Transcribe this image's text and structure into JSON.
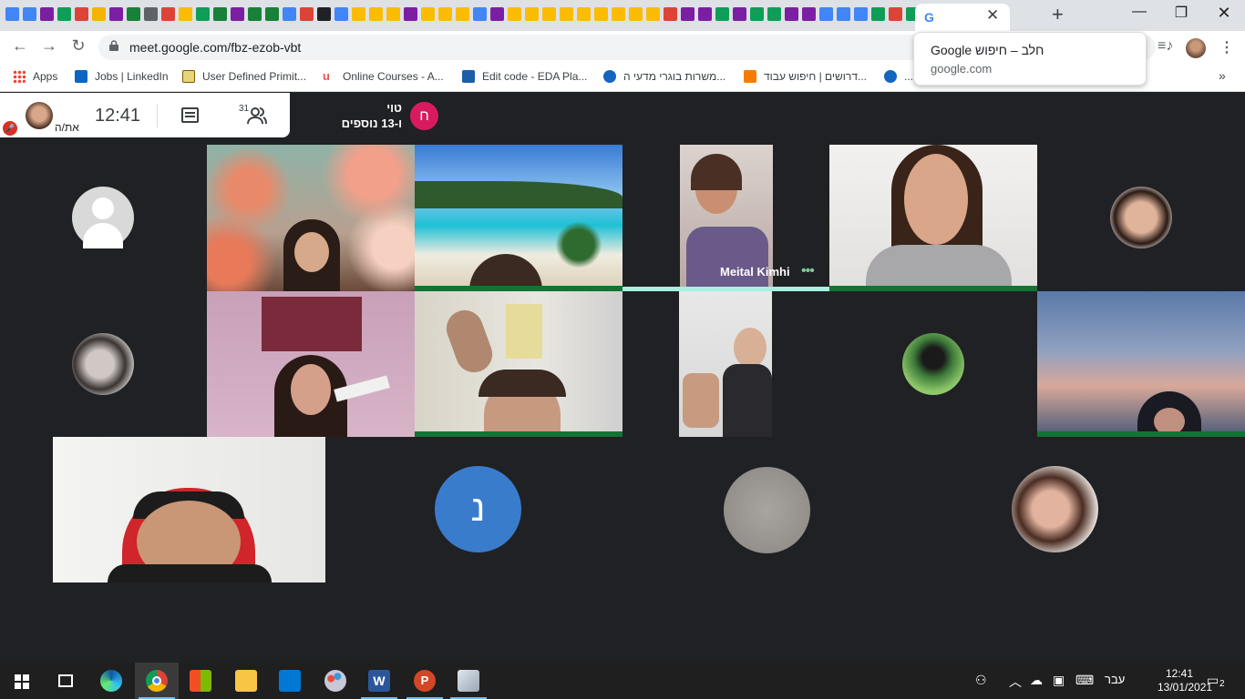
{
  "browser": {
    "active_tab_icon": "G",
    "url": "meet.google.com/fbz-ezob-vbt",
    "tab_icon_colors": [
      "#4285f4",
      "#4285f4",
      "#7b1fa2",
      "#0f9d58",
      "#db4437",
      "#f4b400",
      "#7b1fa2",
      "#188038",
      "#5f6368",
      "#db4437",
      "#fbbc04",
      "#0f9d58",
      "#188038",
      "#7b1fa2",
      "#188038",
      "#188038",
      "#4285f4",
      "#db4437",
      "#202124",
      "#4285f4",
      "#fbbc04",
      "#fbbc04",
      "#fbbc04",
      "#7b1fa2",
      "#fbbc04",
      "#fbbc04",
      "#fbbc04",
      "#4285f4",
      "#7b1fa2",
      "#fbbc04",
      "#fbbc04",
      "#fbbc04",
      "#fbbc04",
      "#fbbc04",
      "#fbbc04",
      "#fbbc04",
      "#fbbc04",
      "#fbbc04",
      "#db4437",
      "#7b1fa2",
      "#7b1fa2",
      "#0f9d58",
      "#7b1fa2",
      "#0f9d58",
      "#0f9d58",
      "#7b1fa2",
      "#7b1fa2",
      "#4285f4",
      "#4285f4",
      "#4285f4",
      "#0f9d58",
      "#db4437",
      "#0f9d58",
      "#7b1fa2",
      "#7b1fa2",
      "#4285f4"
    ],
    "bookmarks": [
      {
        "label": "Apps",
        "icon": "apps-grid-icon",
        "color": "#ea4335"
      },
      {
        "label": "Jobs | LinkedIn",
        "icon": "linkedin-icon",
        "color": "#0a66c2"
      },
      {
        "label": "User Defined Primit...",
        "icon": "chip-icon",
        "color": "#7a5c00"
      },
      {
        "label": "Online Courses - A...",
        "icon": "udemy-icon",
        "color": "#ec5252"
      },
      {
        "label": "Edit code - EDA Pla...",
        "icon": "eda-icon",
        "color": "#1a5fa8"
      },
      {
        "label": "משרות בוגרי מדעי ה...",
        "icon": "jobs-icon",
        "color": "#1565c0"
      },
      {
        "label": "דרושים | חיפוש עבוד...",
        "icon": "t-icon",
        "color": "#f57c00"
      },
      {
        "label": "...",
        "icon": "jobs-icon",
        "color": "#1565c0"
      }
    ]
  },
  "popup": {
    "title": "חלב – חיפוש Google",
    "subtitle": "google.com"
  },
  "meet": {
    "me_label": "את/ה",
    "time": "12:41",
    "participant_count": "31",
    "presenter_initial": "ח",
    "presenter_name": "טוי",
    "presenter_more": "ו-13 נוספים",
    "speaker_name": "Meital Kimhi",
    "speaker_dots": "•••",
    "tile_initial": "נ"
  },
  "taskbar": {
    "language": "עבר",
    "time": "12:41",
    "date": "13/01/2021",
    "notification_count": "2"
  }
}
